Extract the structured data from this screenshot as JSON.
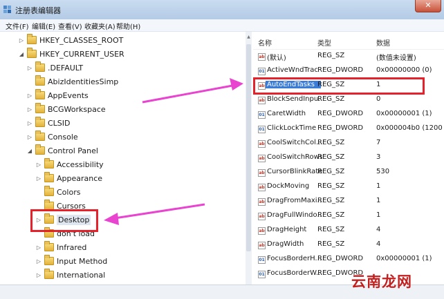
{
  "window": {
    "title": "注册表编辑器",
    "close_glyph": "✕"
  },
  "menu": [
    {
      "label": "文件(F)"
    },
    {
      "label": "编辑(E)"
    },
    {
      "label": "查看(V)"
    },
    {
      "label": "收藏夹(A)"
    },
    {
      "label": "帮助(H)"
    }
  ],
  "tree": {
    "items": [
      {
        "label": "HKEY_CLASSES_ROOT",
        "expander": "▷"
      },
      {
        "label": "HKEY_CURRENT_USER",
        "expander": "◢"
      },
      {
        "label": ".DEFAULT",
        "expander": "▷"
      },
      {
        "label": "AbizIdentitiesSimp",
        "expander": ""
      },
      {
        "label": "AppEvents",
        "expander": "▷"
      },
      {
        "label": "BCGWorkspace",
        "expander": "▷"
      },
      {
        "label": "CLSID",
        "expander": "▷"
      },
      {
        "label": "Console",
        "expander": "▷"
      },
      {
        "label": "Control Panel",
        "expander": "◢"
      },
      {
        "label": "Accessibility",
        "expander": "▷"
      },
      {
        "label": "Appearance",
        "expander": "▷"
      },
      {
        "label": "Colors",
        "expander": ""
      },
      {
        "label": "Cursors",
        "expander": ""
      },
      {
        "label": "Desktop",
        "expander": "▷"
      },
      {
        "label": "don't load",
        "expander": ""
      },
      {
        "label": "Infrared",
        "expander": "▷"
      },
      {
        "label": "Input Method",
        "expander": "▷"
      },
      {
        "label": "International",
        "expander": "▷"
      }
    ]
  },
  "list": {
    "headers": {
      "name": "名称",
      "type": "类型",
      "data": "数据"
    },
    "rows": [
      {
        "name": "(默认)",
        "type": "REG_SZ",
        "data": "(数值未设置)",
        "icon": "ab"
      },
      {
        "name": "ActiveWndTrac",
        "type": "REG_DWORD",
        "data": "0x00000000 (0)",
        "icon": "dword"
      },
      {
        "name": "AutoEndTasks",
        "type": "REG_SZ",
        "data": "1",
        "icon": "ab"
      },
      {
        "name": "BlockSendInpu...",
        "type": "REG_SZ",
        "data": "0",
        "icon": "ab"
      },
      {
        "name": "CaretWidth",
        "type": "REG_DWORD",
        "data": "0x00000001 (1)",
        "icon": "dword"
      },
      {
        "name": "ClickLockTime",
        "type": "REG_DWORD",
        "data": "0x000004b0 (1200)",
        "icon": "dword"
      },
      {
        "name": "CoolSwitchCol...",
        "type": "REG_SZ",
        "data": "7",
        "icon": "ab"
      },
      {
        "name": "CoolSwitchRows",
        "type": "REG_SZ",
        "data": "3",
        "icon": "ab"
      },
      {
        "name": "CursorBlinkRate",
        "type": "REG_SZ",
        "data": "530",
        "icon": "ab"
      },
      {
        "name": "DockMoving",
        "type": "REG_SZ",
        "data": "1",
        "icon": "ab"
      },
      {
        "name": "DragFromMaxi...",
        "type": "REG_SZ",
        "data": "1",
        "icon": "ab"
      },
      {
        "name": "DragFullWindo...",
        "type": "REG_SZ",
        "data": "1",
        "icon": "ab"
      },
      {
        "name": "DragHeight",
        "type": "REG_SZ",
        "data": "4",
        "icon": "ab"
      },
      {
        "name": "DragWidth",
        "type": "REG_SZ",
        "data": "4",
        "icon": "ab"
      },
      {
        "name": "FocusBorderH...",
        "type": "REG_DWORD",
        "data": "0x00000001 (1)",
        "icon": "dword"
      },
      {
        "name": "FocusBorderW...",
        "type": "REG_DWORD",
        "data": "",
        "icon": "dword"
      }
    ]
  },
  "watermark": "云南龙网",
  "colors": {
    "annotation_red": "#e4222c",
    "annotation_arrow": "#e844d0",
    "selection_blue": "#3a7bd5"
  }
}
